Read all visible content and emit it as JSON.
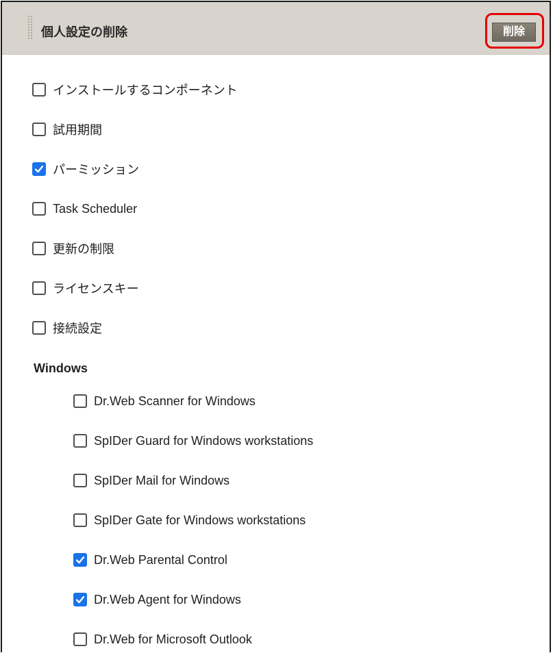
{
  "panel": {
    "title": "個人設定の削除",
    "delete_label": "削除"
  },
  "settings": [
    {
      "label": "インストールするコンポーネント",
      "checked": false
    },
    {
      "label": "試用期間",
      "checked": false
    },
    {
      "label": "パーミッション",
      "checked": true
    },
    {
      "label": "Task Scheduler",
      "checked": false
    },
    {
      "label": "更新の制限",
      "checked": false
    },
    {
      "label": "ライセンスキー",
      "checked": false
    },
    {
      "label": "接続設定",
      "checked": false
    }
  ],
  "windows": {
    "heading": "Windows",
    "items": [
      {
        "label": "Dr.Web Scanner for Windows",
        "checked": false
      },
      {
        "label": "SpIDer Guard for Windows workstations",
        "checked": false
      },
      {
        "label": "SpIDer Mail for Windows",
        "checked": false
      },
      {
        "label": "SpIDer Gate for Windows workstations",
        "checked": false
      },
      {
        "label": "Dr.Web Parental Control",
        "checked": true
      },
      {
        "label": "Dr.Web Agent for Windows",
        "checked": true
      },
      {
        "label": "Dr.Web for Microsoft Outlook",
        "checked": false
      }
    ]
  },
  "colors": {
    "header_bg": "#d8d4cd",
    "checkbox_checked": "#1a73e8",
    "highlight_border": "#e30000",
    "button_bg": "#7d776c"
  }
}
